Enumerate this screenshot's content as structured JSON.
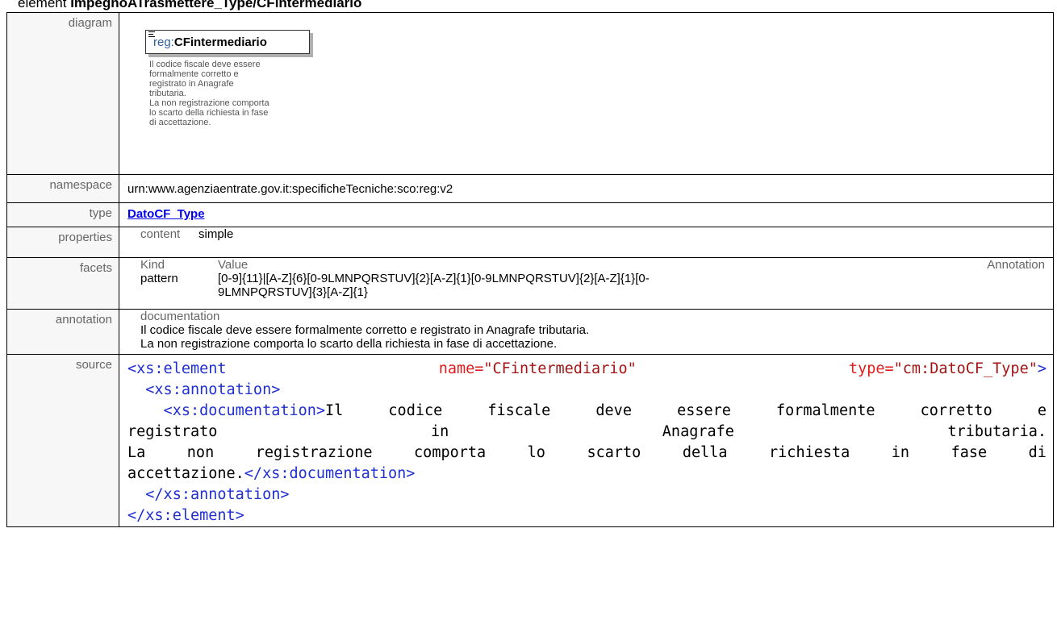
{
  "heading": {
    "prefix": "element ",
    "path": "ImpegnoATrasmettere_Type/CFintermediario"
  },
  "labels": {
    "diagram": "diagram",
    "namespace": "namespace",
    "type": "type",
    "properties": "properties",
    "facets": "facets",
    "annotation": "annotation",
    "source": "source"
  },
  "diagram": {
    "prefix": "reg:",
    "name": "CFintermediario",
    "doc_lines": [
      "Il codice fiscale deve essere",
      "formalmente corretto e",
      "registrato in Anagrafe",
      "tributaria.",
      "La non registrazione comporta",
      "lo scarto della richiesta in fase",
      "di accettazione."
    ]
  },
  "namespace": "urn:www.agenziaentrate.gov.it:specificheTecniche:sco:reg:v2",
  "type_link": "DatoCF_Type",
  "properties": {
    "key": "content",
    "value": "simple"
  },
  "facets": {
    "col_kind": "Kind",
    "col_value": "Value",
    "col_annotation": "Annotation",
    "kind": "pattern",
    "value_line1": "[0-9]{11}|[A-Z]{6}[0-9LMNPQRSTUV]{2}[A-Z]{1}[0-9LMNPQRSTUV]{2}[A-Z]{1}[0-",
    "value_line2": "9LMNPQRSTUV]{3}[A-Z]{1}"
  },
  "annotation": {
    "header": "documentation",
    "line1": "Il codice fiscale deve essere formalmente corretto e registrato in Anagrafe tributaria.",
    "line2": "La non registrazione comporta lo scarto della richiesta in fase di accettazione."
  },
  "source": {
    "l1_open": "<xs:element",
    "l1_name_attr": "name=",
    "l1_name_val": "\"CFintermediario\"",
    "l1_type_attr": "type=",
    "l1_type_val": "\"cm:DatoCF_Type\"",
    "l1_close": ">",
    "l2": "  <xs:annotation>",
    "l3_tag": "    <xs:documentation>",
    "l3_words": [
      "Il",
      "codice",
      "fiscale",
      "deve",
      "essere",
      "formalmente",
      "corretto",
      "e"
    ],
    "l4_words": [
      "registrato",
      "in",
      "Anagrafe",
      "tributaria."
    ],
    "l5_words": [
      "La",
      "non",
      "registrazione",
      "comporta",
      "lo",
      "scarto",
      "della",
      "richiesta",
      "in",
      "fase",
      "di"
    ],
    "l6_text": "accettazione.",
    "l6_close": "</xs:documentation>",
    "l7": "  </xs:annotation>",
    "l8": "</xs:element>"
  },
  "colors": {
    "tag": "#1f2fd1",
    "attr": "#e31b1b",
    "value": "#a31515",
    "label_bg": "#f7f7f7"
  }
}
